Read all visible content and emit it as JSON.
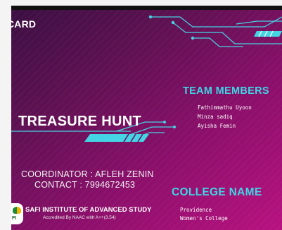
{
  "card": {
    "label": "CARD",
    "event_title": "TREASURE HUNT",
    "coordinator": "COORDINATOR : AFLEH ZENIN",
    "contact": "CONTACT : 7994672453"
  },
  "team": {
    "heading": "TEAM MEMBERS",
    "members": [
      "Fathimmathu Uyoon",
      "Minza sadiq",
      "Ayisha Femin"
    ]
  },
  "college": {
    "heading": "COLLEGE NAME",
    "lines": [
      "Providence",
      "Women's College"
    ]
  },
  "institute": {
    "logo_text": "FI",
    "name": "SAFI INSTITUTE OF ADVANCED STUDY",
    "accreditation": "Accredited By NAAC with A++(3.54)"
  },
  "colors": {
    "accent": "#3fd5e6",
    "background_start": "#3a0f42",
    "background_end": "#b81280"
  }
}
